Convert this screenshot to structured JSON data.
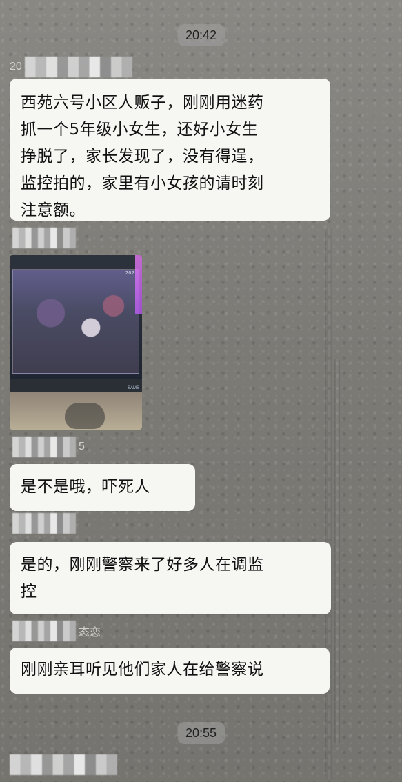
{
  "header": {
    "time_1": "20:42",
    "time_2": "20:55"
  },
  "messages": [
    {
      "sender_suffix": "20",
      "text": "西苑六号小区人贩子，刚刚用迷药\n抓一个5年级小女生，还好小女生\n挣脱了，家长发现了，没有得逞，\n监控拍的，家里有小女孩的请时刻\n注意额。"
    },
    {
      "sender_suffix": "5",
      "text": "是不是哦，吓死人"
    },
    {
      "sender_suffix": "",
      "text": "是的，刚刚警察来了好多人在调监\n控"
    },
    {
      "sender_suffix": "态恋",
      "text": "刚刚亲耳听见他们家人在给警察说"
    }
  ],
  "media": {
    "timestamp_text": "202",
    "logo_text": "SAMS"
  },
  "theme": {
    "bubble_color": "#f6f6f3",
    "background_color": "#7f7d78"
  }
}
